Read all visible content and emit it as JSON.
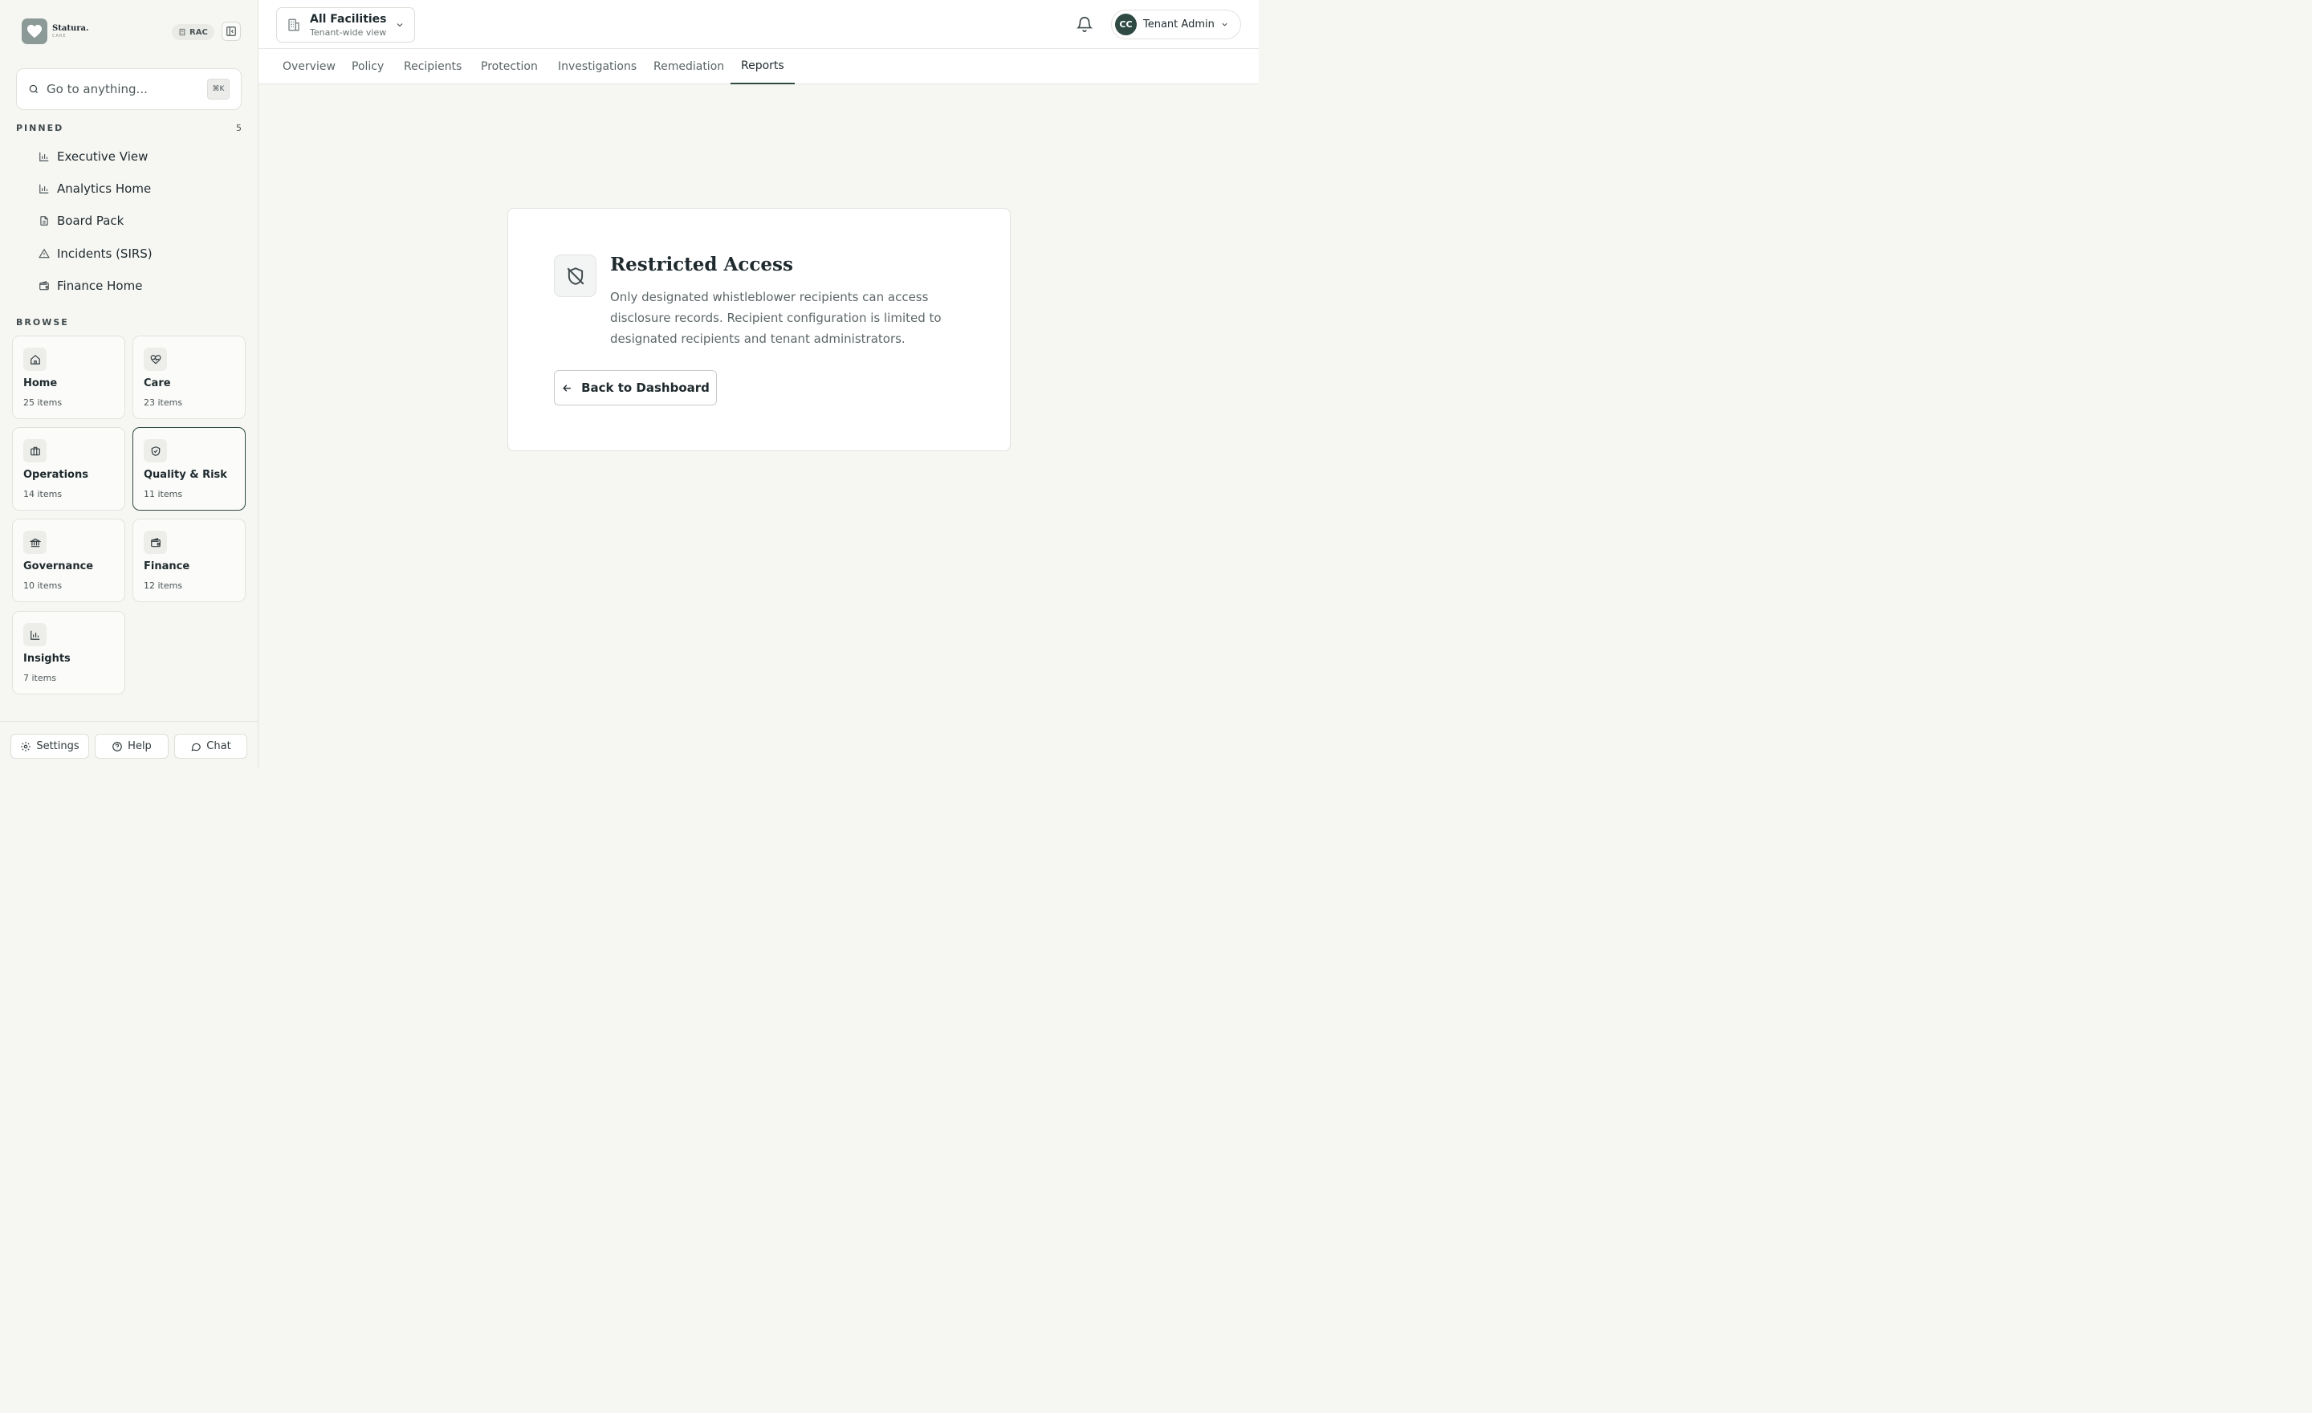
{
  "brand": {
    "name": "Statura.",
    "sub": "CARE"
  },
  "org_badge": "RAC",
  "search": {
    "placeholder": "Go to anything...",
    "shortcut": "⌘K"
  },
  "pinned": {
    "label": "PINNED",
    "count": "5",
    "items": [
      {
        "label": "Executive View",
        "icon": "bar-chart-icon"
      },
      {
        "label": "Analytics Home",
        "icon": "bar-chart-icon"
      },
      {
        "label": "Board Pack",
        "icon": "document-icon"
      },
      {
        "label": "Incidents (SIRS)",
        "icon": "alert-triangle-icon"
      },
      {
        "label": "Finance Home",
        "icon": "wallet-icon"
      }
    ]
  },
  "browse": {
    "label": "BROWSE",
    "tiles": [
      {
        "name": "Home",
        "count": "25 items",
        "icon": "home-icon"
      },
      {
        "name": "Care",
        "count": "23 items",
        "icon": "heart-pulse-icon"
      },
      {
        "name": "Operations",
        "count": "14 items",
        "icon": "briefcase-icon"
      },
      {
        "name": "Quality & Risk",
        "count": "11 items",
        "icon": "shield-check-icon",
        "active": true
      },
      {
        "name": "Governance",
        "count": "10 items",
        "icon": "landmark-icon"
      },
      {
        "name": "Finance",
        "count": "12 items",
        "icon": "wallet-icon"
      },
      {
        "name": "Insights",
        "count": "7 items",
        "icon": "bar-chart-icon"
      }
    ]
  },
  "footer": {
    "settings": "Settings",
    "help": "Help",
    "chat": "Chat"
  },
  "facility": {
    "title": "All Facilities",
    "subtitle": "Tenant-wide view"
  },
  "user": {
    "initials": "CC",
    "name": "Tenant Admin"
  },
  "tabs": [
    {
      "label": "Overview"
    },
    {
      "label": "Policy"
    },
    {
      "label": "Recipients"
    },
    {
      "label": "Protection"
    },
    {
      "label": "Investigations"
    },
    {
      "label": "Remediation"
    },
    {
      "label": "Reports",
      "active": true
    }
  ],
  "restricted": {
    "title": "Restricted Access",
    "body": "Only designated whistleblower recipients can access disclosure records. Recipient configuration is limited to designated recipients and tenant administrators.",
    "button": "Back to Dashboard"
  },
  "colors": {
    "accent": "#2f4a43",
    "background": "#f6f6f3"
  }
}
